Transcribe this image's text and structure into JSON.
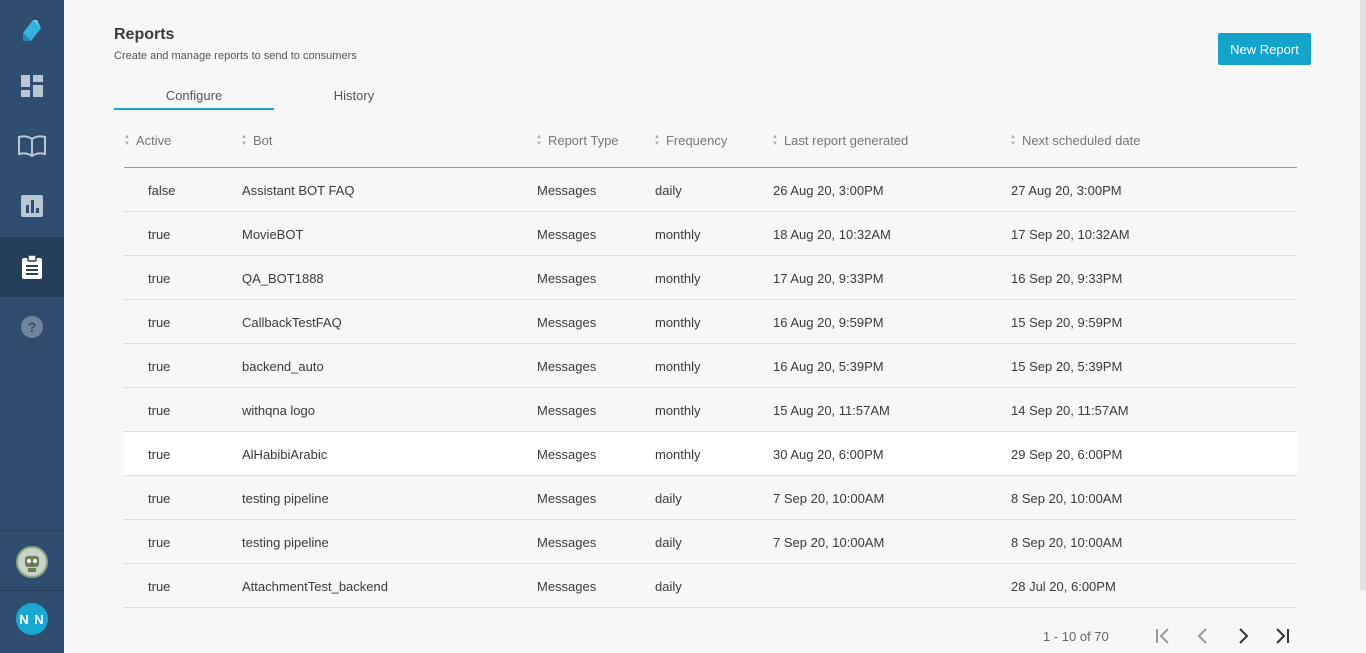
{
  "sidebar": {
    "items": [
      {
        "icon": "app-logo-icon"
      },
      {
        "icon": "dashboard-icon"
      },
      {
        "icon": "book-icon"
      },
      {
        "icon": "analytics-icon"
      },
      {
        "icon": "clipboard-icon"
      },
      {
        "icon": "help-icon"
      }
    ],
    "user_initials": "N N"
  },
  "header": {
    "title": "Reports",
    "subtitle": "Create and manage reports to send to consumers",
    "new_button": "New Report"
  },
  "tabs": [
    {
      "label": "Configure",
      "active": true
    },
    {
      "label": "History",
      "active": false
    }
  ],
  "table": {
    "columns": [
      "Active",
      "Bot",
      "Report Type",
      "Frequency",
      "Last report generated",
      "Next scheduled date"
    ],
    "rows": [
      {
        "active": "false",
        "bot": "Assistant BOT FAQ",
        "type": "Messages",
        "frequency": "daily",
        "last": "26 Aug 20, 3:00PM",
        "next": "27 Aug 20, 3:00PM"
      },
      {
        "active": "true",
        "bot": "MovieBOT",
        "type": "Messages",
        "frequency": "monthly",
        "last": "18 Aug 20, 10:32AM",
        "next": "17 Sep 20, 10:32AM"
      },
      {
        "active": "true",
        "bot": "QA_BOT1888",
        "type": "Messages",
        "frequency": "monthly",
        "last": "17 Aug 20, 9:33PM",
        "next": "16 Sep 20, 9:33PM"
      },
      {
        "active": "true",
        "bot": "CallbackTestFAQ",
        "type": "Messages",
        "frequency": "monthly",
        "last": "16 Aug 20, 9:59PM",
        "next": "15 Sep 20, 9:59PM"
      },
      {
        "active": "true",
        "bot": "backend_auto",
        "type": "Messages",
        "frequency": "monthly",
        "last": "16 Aug 20, 5:39PM",
        "next": "15 Sep 20, 5:39PM"
      },
      {
        "active": "true",
        "bot": "withqna logo",
        "type": "Messages",
        "frequency": "monthly",
        "last": "15 Aug 20, 11:57AM",
        "next": "14 Sep 20, 11:57AM"
      },
      {
        "active": "true",
        "bot": "AlHabibiArabic",
        "type": "Messages",
        "frequency": "monthly",
        "last": "30 Aug 20, 6:00PM",
        "next": "29 Sep 20, 6:00PM"
      },
      {
        "active": "true",
        "bot": "testing pipeline",
        "type": "Messages",
        "frequency": "daily",
        "last": "7 Sep 20, 10:00AM",
        "next": "8 Sep 20, 10:00AM"
      },
      {
        "active": "true",
        "bot": "testing pipeline",
        "type": "Messages",
        "frequency": "daily",
        "last": "7 Sep 20, 10:00AM",
        "next": "8 Sep 20, 10:00AM"
      },
      {
        "active": "true",
        "bot": "AttachmentTest_backend",
        "type": "Messages",
        "frequency": "daily",
        "last": "",
        "next": "28 Jul 20, 6:00PM"
      }
    ]
  },
  "pagination": {
    "label": "1 - 10 of 70"
  },
  "colors": {
    "sidebar": "#2f4e6f",
    "accent": "#14a3cb"
  }
}
